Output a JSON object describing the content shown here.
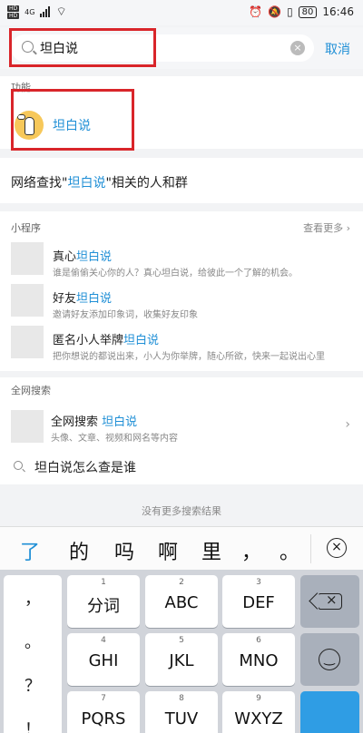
{
  "status_bar": {
    "sim_labels": [
      "HD",
      "HD"
    ],
    "network": "4G",
    "battery": "80",
    "time": "16:46"
  },
  "search": {
    "query": "坦白说",
    "cancel_label": "取消"
  },
  "function_section": {
    "label": "功能",
    "item_label": "坦白说"
  },
  "network_search": {
    "prefix": "网络查找\"",
    "keyword": "坦白说",
    "suffix": "\"相关的人和群"
  },
  "mini_programs": {
    "label": "小程序",
    "more": "查看更多",
    "items": [
      {
        "title_prefix": "真心",
        "title_keyword": "坦白说",
        "desc": "谁是偷偷关心你的人？真心坦白说，给彼此一个了解的机会。"
      },
      {
        "title_prefix": "好友",
        "title_keyword": "坦白说",
        "desc": "邀请好友添加印象词，收集好友印象"
      },
      {
        "title_prefix": "匿名小人举牌",
        "title_keyword": "坦白说",
        "desc": "把你想说的都说出来，小人为你举牌，随心所欲，快来一起说出心里"
      }
    ]
  },
  "web_search": {
    "label": "全网搜索",
    "title": "全网搜索",
    "keyword": "坦白说",
    "desc": "头像、文章、视频和网名等内容",
    "suggestion": "坦白说怎么查是谁"
  },
  "no_more": "没有更多搜索结果",
  "candidates": [
    "了",
    "的",
    "吗",
    "啊",
    "里",
    "，",
    "。"
  ],
  "keyboard": {
    "punctuation": [
      "，",
      "。",
      "？",
      "！"
    ],
    "keys": [
      {
        "num": "1",
        "label": "分词"
      },
      {
        "num": "2",
        "label": "ABC"
      },
      {
        "num": "3",
        "label": "DEF"
      },
      {
        "num": "4",
        "label": "GHI"
      },
      {
        "num": "5",
        "label": "JKL"
      },
      {
        "num": "6",
        "label": "MNO"
      },
      {
        "num": "7",
        "label": "PQRS"
      },
      {
        "num": "8",
        "label": "TUV"
      },
      {
        "num": "9",
        "label": "WXYZ"
      }
    ]
  },
  "colors": {
    "accent": "#1f8fd6",
    "highlight_box": "#d9252a",
    "enter_key": "#2f9de4"
  }
}
